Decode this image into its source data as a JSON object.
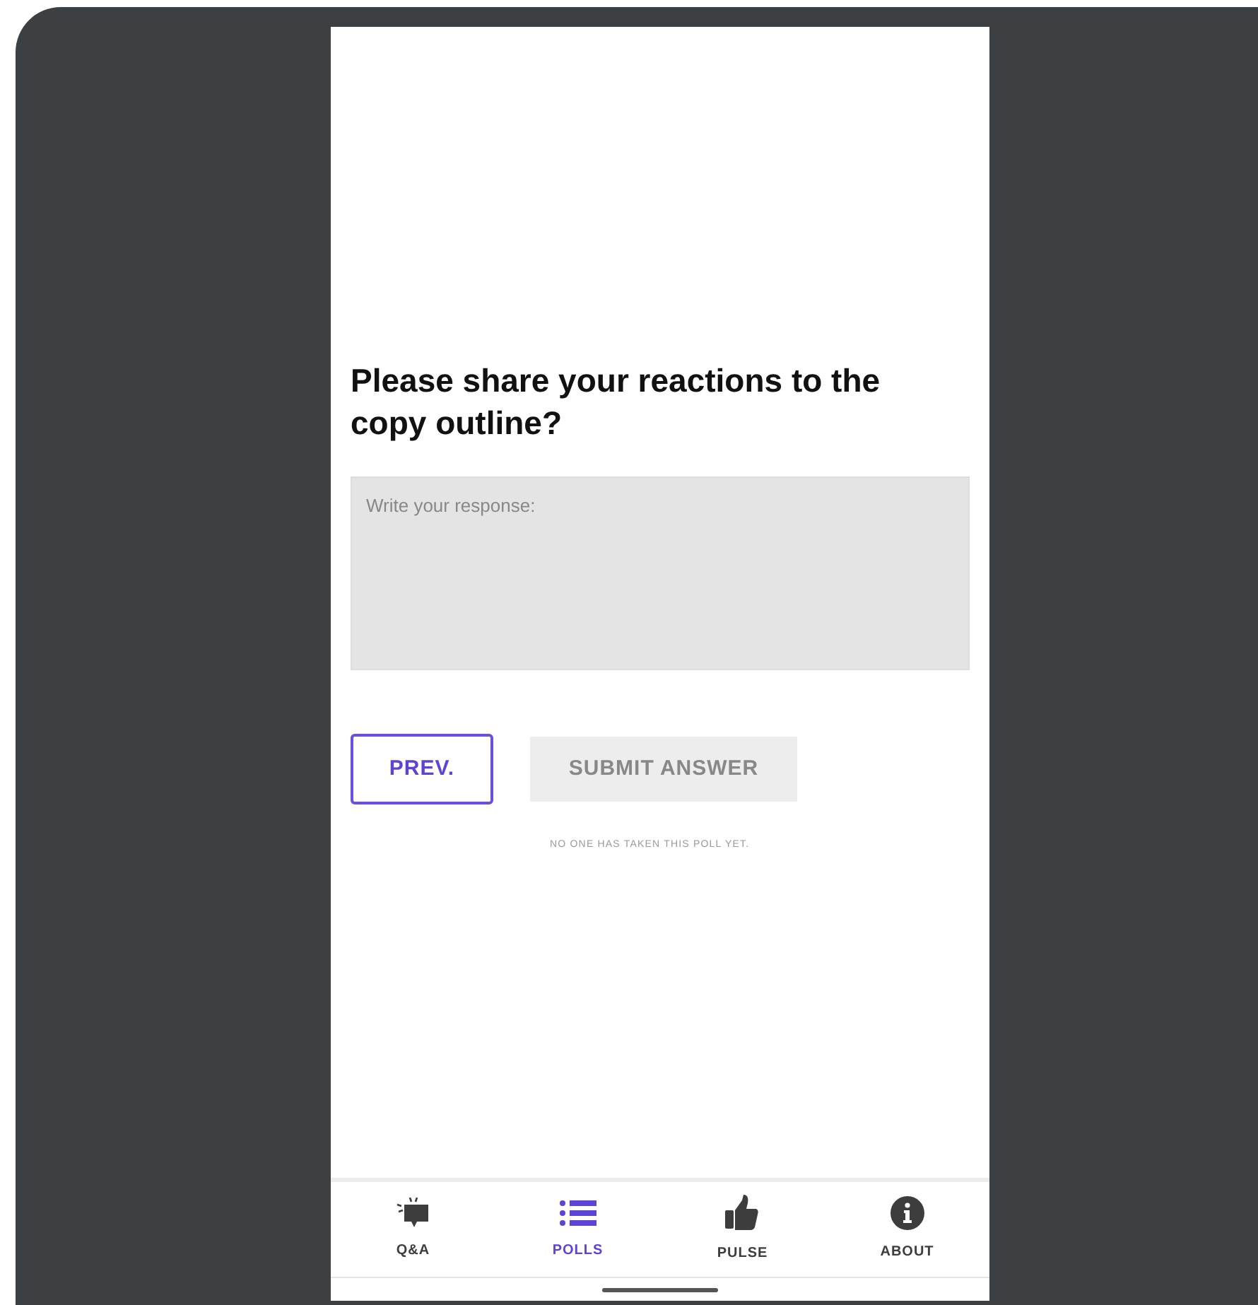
{
  "question": "Please share your reactions to the copy outline?",
  "response_field": {
    "placeholder": "Write your response:"
  },
  "buttons": [
    {
      "label": "PREV.",
      "kind": "outline",
      "disabled": false
    },
    {
      "label": "SUBMIT ANSWER",
      "kind": "filled",
      "disabled": true
    }
  ],
  "poll_note": "NO ONE HAS TAKEN THIS POLL YET.",
  "tabs": [
    {
      "label": "Q&A",
      "kind": "qa",
      "selected": false
    },
    {
      "label": "POLLS",
      "kind": "polls",
      "selected": true
    },
    {
      "label": "PULSE",
      "kind": "pulse",
      "selected": false
    },
    {
      "label": "ABOUT",
      "kind": "about",
      "selected": false
    }
  ]
}
